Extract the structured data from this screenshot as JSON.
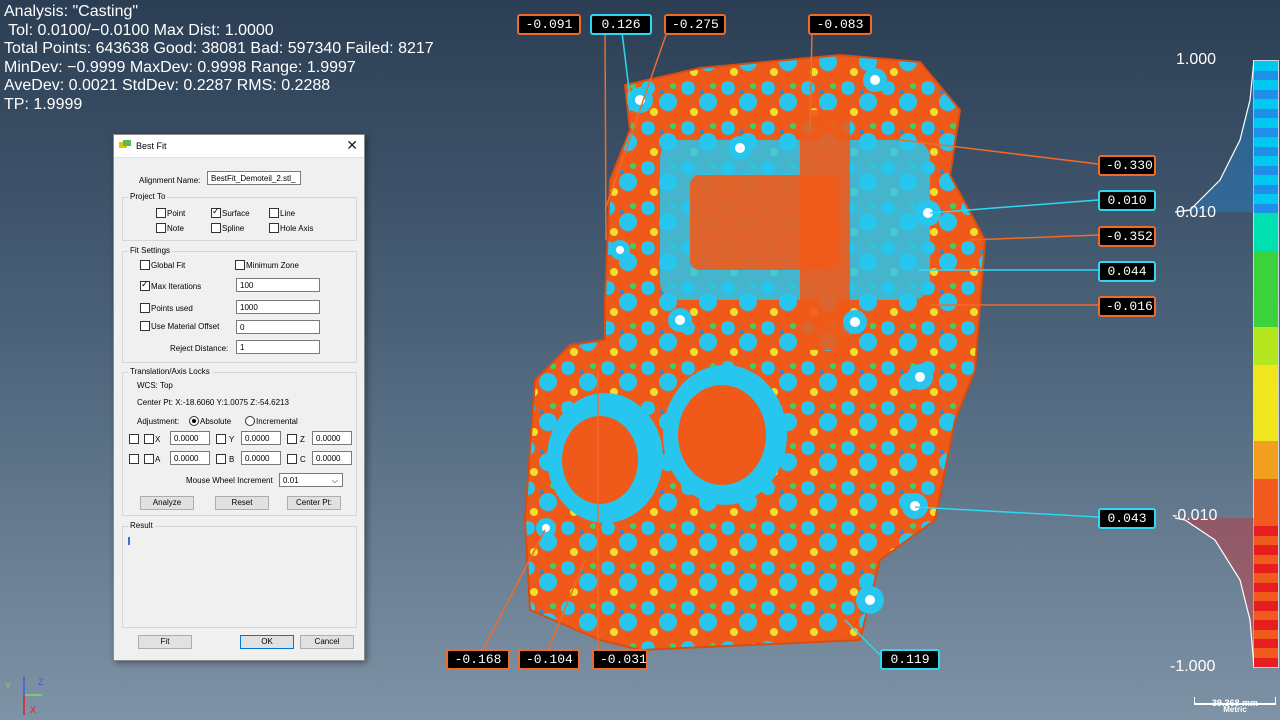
{
  "hud": {
    "analysis": "Analysis: \"Casting\"",
    "tolerance": " Tol: 0.0100/−0.0100 Max Dist: 1.0000",
    "points": "Total Points: 643638 Good: 38081 Bad: 597340 Failed: 8217",
    "minmax": "MinDev: −0.9999 MaxDev: 0.9998 Range: 1.9997",
    "stats": "AveDev: 0.0021 StdDev: 0.2287 RMS: 0.2288",
    "tp": "TP: 1.9999"
  },
  "callouts": [
    {
      "value": "-0.091",
      "sign": "neg"
    },
    {
      "value": "0.126",
      "sign": "pos"
    },
    {
      "value": "-0.275",
      "sign": "neg"
    },
    {
      "value": "-0.083",
      "sign": "neg"
    },
    {
      "value": "-0.330",
      "sign": "neg"
    },
    {
      "value": "0.010",
      "sign": "pos"
    },
    {
      "value": "-0.352",
      "sign": "neg"
    },
    {
      "value": "0.044",
      "sign": "pos"
    },
    {
      "value": "-0.016",
      "sign": "neg"
    },
    {
      "value": "0.043",
      "sign": "pos"
    },
    {
      "value": "-0.168",
      "sign": "neg"
    },
    {
      "value": "-0.104",
      "sign": "neg"
    },
    {
      "value": "-0.031",
      "sign": "neg"
    },
    {
      "value": "0.119",
      "sign": "pos"
    }
  ],
  "scale": {
    "max_label": "1.000",
    "upper_tol_label": "0.010",
    "lower_tol_label": "-0.010",
    "min_label": "-1.000",
    "colors": [
      "#1f8fe8",
      "#00c8f0",
      "#00e0b0",
      "#3cd23c",
      "#b4e61e",
      "#f0e61e",
      "#f0a01e",
      "#f05a1e",
      "#e61e1e"
    ]
  },
  "dialog": {
    "title": "Best Fit",
    "alignment_name_label": "Alignment Name:",
    "alignment_name_value": "BestFit_Demoteil_2.stl_",
    "project_to": {
      "title": "Project To",
      "point": "Point",
      "surface": "Surface",
      "line": "Line",
      "note": "Note",
      "spline": "Spline",
      "hole_axis": "Hole Axis"
    },
    "fit_settings": {
      "title": "Fit Settings",
      "global_fit": "Global Fit",
      "minimum_zone": "Minimum Zone",
      "max_iterations": "Max Iterations",
      "max_iterations_value": "100",
      "points_used": "Points used",
      "points_used_value": "1000",
      "use_material_offset": "Use Material Offset",
      "material_offset_value": "0",
      "reject_distance": "Reject Distance:",
      "reject_distance_value": "1"
    },
    "locks": {
      "title": "Translation/Axis Locks",
      "wcs": "WCS:  Top",
      "center_pt": "Center Pt:  X:-18.6060 Y:1.0075 Z:-54.6213",
      "adjustment": "Adjustment:",
      "absolute": "Absolute",
      "incremental": "Incremental",
      "x": "X",
      "y": "Y",
      "z": "Z",
      "a": "A",
      "b": "B",
      "c": "C",
      "x_val": "0.0000",
      "y_val": "0.0000",
      "z_val": "0.0000",
      "a_val": "0.0000",
      "b_val": "0.0000",
      "c_val": "0.0000",
      "mouse_wheel": "Mouse Wheel Increment",
      "mouse_wheel_value": "0.01",
      "analyze": "Analyze",
      "reset": "Reset",
      "center_pt_button": "Center Pt:"
    },
    "result": {
      "title": "Result"
    },
    "buttons": {
      "fit": "Fit",
      "ok": "OK",
      "cancel": "Cancel"
    }
  },
  "axes": {
    "x": "X",
    "y": "Y",
    "z": "Z"
  },
  "scalebar": {
    "length": "39.368 mm",
    "unit": "Metric"
  }
}
